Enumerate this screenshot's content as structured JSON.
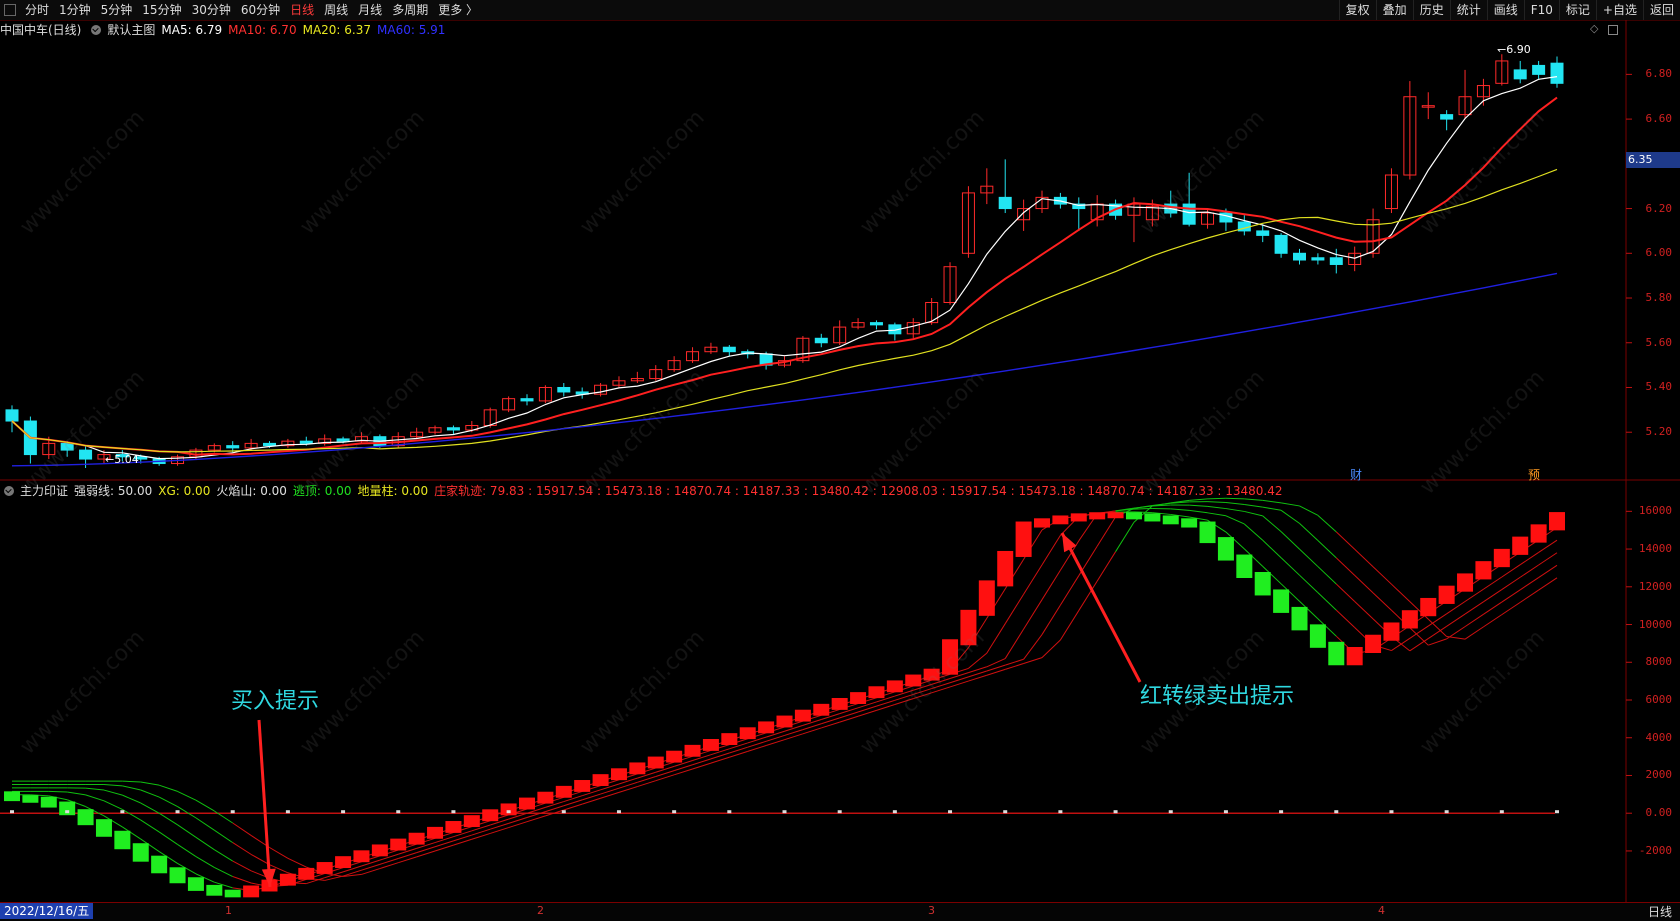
{
  "toolbar": {
    "left_items": [
      "分时",
      "1分钟",
      "5分钟",
      "15分钟",
      "30分钟",
      "60分钟",
      "日线",
      "周线",
      "月线",
      "多周期",
      "更多 〉"
    ],
    "active": "日线",
    "right_items": [
      "复权",
      "叠加",
      "历史",
      "统计",
      "画线",
      "F10",
      "标记",
      "+自选",
      "返回"
    ]
  },
  "main_info": {
    "stock": "中国中车(日线)",
    "template": "默认主图",
    "ma5": "MA5: 6.79",
    "ma10": "MA10: 6.70",
    "ma20": "MA20: 6.37",
    "ma60": "MA60: 5.91"
  },
  "indicator_info": {
    "name": "主力印证",
    "strong": "强弱线: 50.00",
    "xg": "XG: 0.00",
    "volcano": "火焰山: 0.00",
    "escape": "逃顶: 0.00",
    "ground": "地量柱: 0.00",
    "trace": "庄家轨迹: 79.83 : 15917.54 : 15473.18 : 14870.74 : 14187.33 : 13480.42 : 12908.03 : 15917.54 : 15473.18 : 14870.74 : 14187.33 : 13480.42"
  },
  "price_axis": [
    "6.80",
    "6.60",
    "6.40",
    "6.20",
    "6.00",
    "5.80",
    "5.60",
    "5.40",
    "5.20"
  ],
  "current_price": "6.35",
  "indicator_axis": [
    "16000",
    "14000",
    "12000",
    "10000",
    "8000",
    "6000",
    "4000",
    "2000",
    "0.00",
    "-2000"
  ],
  "bottom": {
    "date": "2022/12/16/五",
    "months": [
      "1",
      "2",
      "3",
      "4"
    ],
    "period": "日线"
  },
  "labels": {
    "high": "6.90",
    "low": "5.04",
    "event_cai": "财",
    "event_yu": "预"
  },
  "annotations": {
    "buy": "买入提示",
    "sell": "红转绿卖出提示"
  },
  "watermark": "www.cfchi.com",
  "colors": {
    "up": "#ff2a2a",
    "down": "#22e5f2",
    "ma5": "#ffffff",
    "ma10": "#ff2020",
    "ma20": "#e0e020",
    "ma60": "#2020e0",
    "ind_up": "#ff1010",
    "ind_down": "#20ee20",
    "annot": "#2fd8e0"
  },
  "chart_data": [
    {
      "type": "candlestick",
      "title": "中国中车(日线)",
      "y_range": [
        5.04,
        6.9
      ],
      "candles": [
        [
          5.3,
          5.25,
          5.32,
          5.2
        ],
        [
          5.25,
          5.1,
          5.27,
          5.06
        ],
        [
          5.1,
          5.15,
          5.18,
          5.08
        ],
        [
          5.15,
          5.12,
          5.16,
          5.09
        ],
        [
          5.12,
          5.08,
          5.14,
          5.04
        ],
        [
          5.08,
          5.1,
          5.12,
          5.06
        ],
        [
          5.1,
          5.09,
          5.12,
          5.07
        ],
        [
          5.09,
          5.08,
          5.1,
          5.06
        ],
        [
          5.08,
          5.06,
          5.09,
          5.05
        ],
        [
          5.06,
          5.09,
          5.1,
          5.05
        ],
        [
          5.09,
          5.12,
          5.13,
          5.08
        ],
        [
          5.12,
          5.14,
          5.15,
          5.11
        ],
        [
          5.14,
          5.13,
          5.16,
          5.11
        ],
        [
          5.13,
          5.15,
          5.17,
          5.12
        ],
        [
          5.15,
          5.14,
          5.16,
          5.13
        ],
        [
          5.14,
          5.16,
          5.17,
          5.13
        ],
        [
          5.16,
          5.15,
          5.18,
          5.14
        ],
        [
          5.15,
          5.17,
          5.19,
          5.14
        ],
        [
          5.17,
          5.16,
          5.18,
          5.15
        ],
        [
          5.16,
          5.18,
          5.2,
          5.15
        ],
        [
          5.18,
          5.14,
          5.19,
          5.13
        ],
        [
          5.14,
          5.18,
          5.2,
          5.13
        ],
        [
          5.18,
          5.2,
          5.22,
          5.17
        ],
        [
          5.2,
          5.22,
          5.23,
          5.19
        ],
        [
          5.22,
          5.21,
          5.23,
          5.19
        ],
        [
          5.21,
          5.23,
          5.25,
          5.2
        ],
        [
          5.23,
          5.3,
          5.31,
          5.22
        ],
        [
          5.3,
          5.35,
          5.36,
          5.29
        ],
        [
          5.35,
          5.34,
          5.37,
          5.32
        ],
        [
          5.34,
          5.4,
          5.41,
          5.33
        ],
        [
          5.4,
          5.38,
          5.42,
          5.36
        ],
        [
          5.38,
          5.37,
          5.4,
          5.35
        ],
        [
          5.37,
          5.41,
          5.42,
          5.36
        ],
        [
          5.41,
          5.43,
          5.45,
          5.4
        ],
        [
          5.43,
          5.44,
          5.47,
          5.42
        ],
        [
          5.44,
          5.48,
          5.5,
          5.43
        ],
        [
          5.48,
          5.52,
          5.54,
          5.47
        ],
        [
          5.52,
          5.56,
          5.58,
          5.51
        ],
        [
          5.56,
          5.58,
          5.6,
          5.55
        ],
        [
          5.58,
          5.56,
          5.59,
          5.54
        ],
        [
          5.56,
          5.55,
          5.57,
          5.53
        ],
        [
          5.55,
          5.5,
          5.56,
          5.48
        ],
        [
          5.5,
          5.52,
          5.54,
          5.49
        ],
        [
          5.52,
          5.62,
          5.63,
          5.51
        ],
        [
          5.62,
          5.6,
          5.64,
          5.58
        ],
        [
          5.6,
          5.67,
          5.7,
          5.59
        ],
        [
          5.67,
          5.69,
          5.71,
          5.66
        ],
        [
          5.69,
          5.68,
          5.7,
          5.66
        ],
        [
          5.68,
          5.64,
          5.69,
          5.61
        ],
        [
          5.64,
          5.69,
          5.71,
          5.62
        ],
        [
          5.69,
          5.78,
          5.8,
          5.68
        ],
        [
          5.78,
          5.94,
          5.96,
          5.77
        ],
        [
          6.0,
          6.27,
          6.3,
          5.98
        ],
        [
          6.27,
          6.3,
          6.38,
          6.22
        ],
        [
          6.25,
          6.2,
          6.42,
          6.18
        ],
        [
          6.15,
          6.2,
          6.24,
          6.1
        ],
        [
          6.2,
          6.25,
          6.28,
          6.18
        ],
        [
          6.25,
          6.22,
          6.27,
          6.2
        ],
        [
          6.22,
          6.2,
          6.25,
          6.1
        ],
        [
          6.15,
          6.22,
          6.26,
          6.12
        ],
        [
          6.22,
          6.17,
          6.24,
          6.15
        ],
        [
          6.17,
          6.22,
          6.25,
          6.05
        ],
        [
          6.15,
          6.21,
          6.24,
          6.12
        ],
        [
          6.22,
          6.18,
          6.28,
          6.16
        ],
        [
          6.22,
          6.13,
          6.36,
          6.12
        ],
        [
          6.13,
          6.18,
          6.2,
          6.11
        ],
        [
          6.18,
          6.14,
          6.2,
          6.1
        ],
        [
          6.14,
          6.1,
          6.17,
          6.08
        ],
        [
          6.1,
          6.08,
          6.13,
          6.05
        ],
        [
          6.08,
          6.0,
          6.09,
          5.98
        ],
        [
          6.0,
          5.97,
          6.02,
          5.95
        ],
        [
          5.98,
          5.97,
          6.0,
          5.95
        ],
        [
          5.98,
          5.95,
          6.02,
          5.91
        ],
        [
          5.95,
          6.0,
          6.03,
          5.92
        ],
        [
          6.0,
          6.15,
          6.2,
          5.98
        ],
        [
          6.2,
          6.35,
          6.38,
          6.18
        ],
        [
          6.35,
          6.7,
          6.77,
          6.33
        ],
        [
          6.66,
          6.66,
          6.72,
          6.6
        ],
        [
          6.62,
          6.6,
          6.64,
          6.55
        ],
        [
          6.62,
          6.7,
          6.82,
          6.6
        ],
        [
          6.7,
          6.75,
          6.78,
          6.66
        ],
        [
          6.76,
          6.86,
          6.89,
          6.75
        ],
        [
          6.82,
          6.78,
          6.86,
          6.76
        ],
        [
          6.84,
          6.8,
          6.86,
          6.78
        ],
        [
          6.85,
          6.76,
          6.88,
          6.74
        ]
      ],
      "ma_series": [
        "MA5",
        "MA10",
        "MA20",
        "MA60"
      ]
    },
    {
      "type": "indicator",
      "title": "主力印证",
      "y_range": [
        -2000,
        16000
      ],
      "series": [
        {
          "name": "庄家轨迹",
          "values": [
            79.83,
            15917.54,
            15473.18,
            14870.74,
            14187.33,
            13480.42,
            12908.03
          ]
        }
      ]
    }
  ]
}
